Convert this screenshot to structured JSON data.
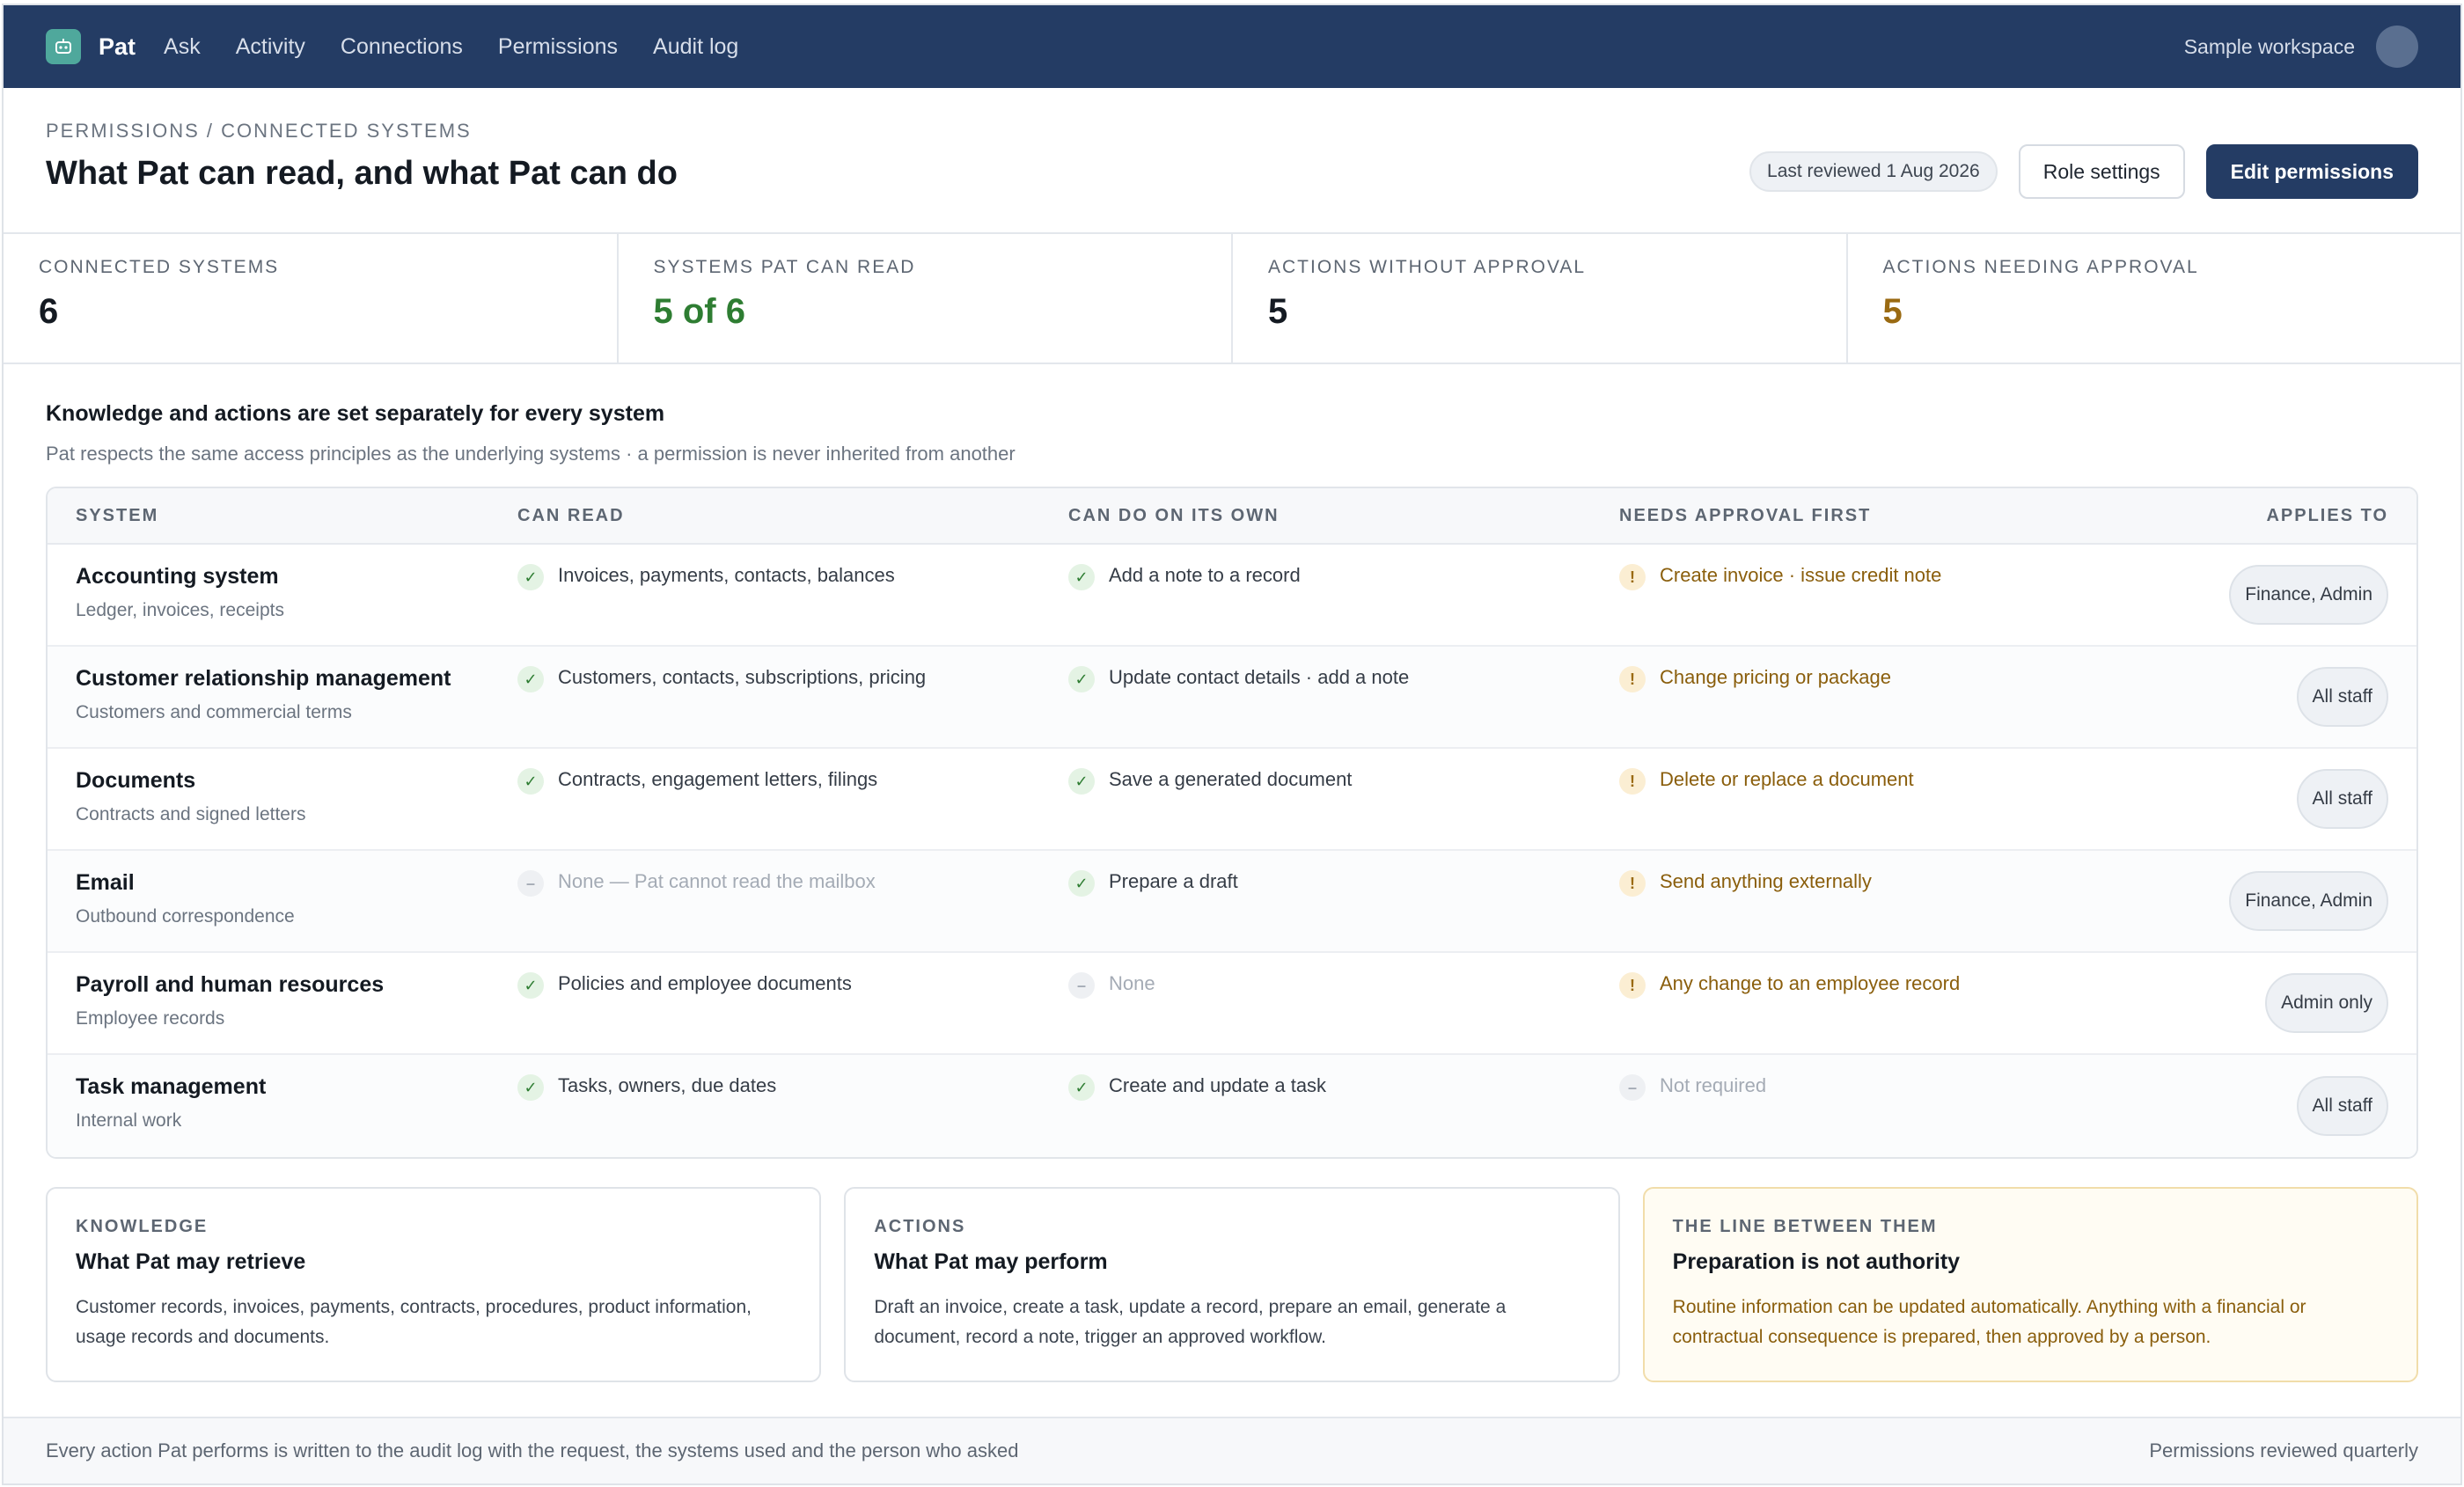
{
  "nav": {
    "brand": "Pat",
    "links": [
      "Ask",
      "Activity",
      "Connections",
      "Permissions",
      "Audit log"
    ],
    "workspace": "Sample workspace"
  },
  "header": {
    "breadcrumb": "PERMISSIONS / CONNECTED SYSTEMS",
    "title": "What Pat can read, and what Pat can do",
    "last_reviewed": "Last reviewed 1 Aug 2026",
    "role_settings_label": "Role settings",
    "edit_permissions_label": "Edit permissions"
  },
  "stats": [
    {
      "label": "CONNECTED SYSTEMS",
      "value": "6",
      "tone": "default"
    },
    {
      "label": "SYSTEMS PAT CAN READ",
      "value": "5 of 6",
      "tone": "green"
    },
    {
      "label": "ACTIONS WITHOUT APPROVAL",
      "value": "5",
      "tone": "default"
    },
    {
      "label": "ACTIONS NEEDING APPROVAL",
      "value": "5",
      "tone": "amber"
    }
  ],
  "section": {
    "title": "Knowledge and actions are set separately for every system",
    "subtitle": "Pat respects the same access principles as the underlying systems · a permission is never inherited from another"
  },
  "table": {
    "headers": [
      "SYSTEM",
      "CAN READ",
      "CAN DO ON ITS OWN",
      "NEEDS APPROVAL FIRST",
      "APPLIES TO"
    ],
    "rows": [
      {
        "name": "Accounting system",
        "desc": "Ledger, invoices, receipts",
        "read": {
          "text": "Invoices, payments, contacts, balances",
          "state": "check"
        },
        "do": {
          "text": "Add a note to a record",
          "state": "check"
        },
        "approval": {
          "text": "Create invoice · issue credit note",
          "state": "warn"
        },
        "applies": "Finance, Admin"
      },
      {
        "name": "Customer relationship management",
        "desc": "Customers and commercial terms",
        "read": {
          "text": "Customers, contacts, subscriptions, pricing",
          "state": "check"
        },
        "do": {
          "text": "Update contact details · add a note",
          "state": "check"
        },
        "approval": {
          "text": "Change pricing or package",
          "state": "warn"
        },
        "applies": "All staff"
      },
      {
        "name": "Documents",
        "desc": "Contracts and signed letters",
        "read": {
          "text": "Contracts, engagement letters, filings",
          "state": "check"
        },
        "do": {
          "text": "Save a generated document",
          "state": "check"
        },
        "approval": {
          "text": "Delete or replace a document",
          "state": "warn"
        },
        "applies": "All staff"
      },
      {
        "name": "Email",
        "desc": "Outbound correspondence",
        "read": {
          "text": "None — Pat cannot read the mailbox",
          "state": "none"
        },
        "do": {
          "text": "Prepare a draft",
          "state": "check"
        },
        "approval": {
          "text": "Send anything externally",
          "state": "warn"
        },
        "applies": "Finance, Admin"
      },
      {
        "name": "Payroll and human resources",
        "desc": "Employee records",
        "read": {
          "text": "Policies and employee documents",
          "state": "check"
        },
        "do": {
          "text": "None",
          "state": "none"
        },
        "approval": {
          "text": "Any change to an employee record",
          "state": "warn"
        },
        "applies": "Admin only"
      },
      {
        "name": "Task management",
        "desc": "Internal work",
        "read": {
          "text": "Tasks, owners, due dates",
          "state": "check"
        },
        "do": {
          "text": "Create and update a task",
          "state": "check"
        },
        "approval": {
          "text": "Not required",
          "state": "none"
        },
        "applies": "All staff"
      }
    ]
  },
  "cards": [
    {
      "kicker": "KNOWLEDGE",
      "title": "What Pat may retrieve",
      "body": "Customer records, invoices, payments, contracts, procedures, product information, usage records and documents.",
      "tone": "default"
    },
    {
      "kicker": "ACTIONS",
      "title": "What Pat may perform",
      "body": "Draft an invoice, create a task, update a record, prepare an email, generate a document, record a note, trigger an approved workflow.",
      "tone": "default"
    },
    {
      "kicker": "THE LINE BETWEEN THEM",
      "title": "Preparation is not authority",
      "body": "Routine information can be updated automatically. Anything with a financial or contractual consequence is prepared, then approved by a person.",
      "tone": "amber"
    }
  ],
  "footer": {
    "left": "Every action Pat performs is written to the audit log with the request, the systems used and the person who asked",
    "right": "Permissions reviewed quarterly"
  },
  "icons": {
    "check": "check-icon",
    "none": "dash-icon",
    "warn": "exclamation-icon",
    "brand": "robot-icon"
  },
  "colors": {
    "nav": "#243c64",
    "accent_green": "#2e7d32",
    "accent_amber": "#9a6a12",
    "brand_logo": "#4fa89c"
  }
}
